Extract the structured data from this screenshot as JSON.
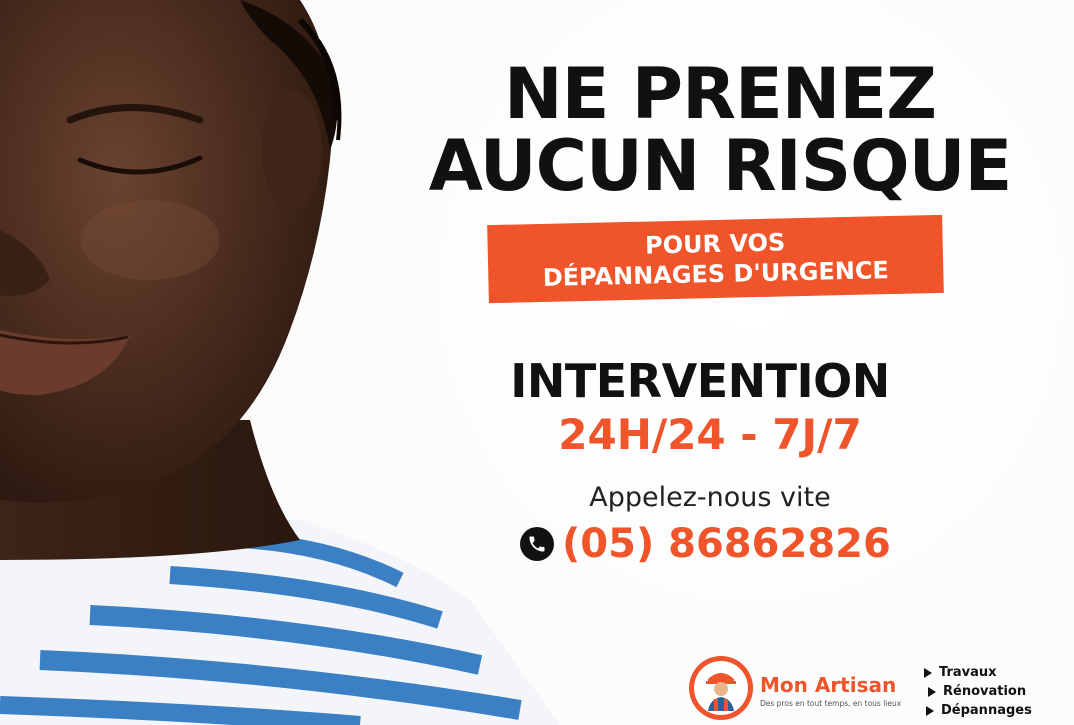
{
  "headline": {
    "line1": "NE PRENEZ",
    "line2": "AUCUN RISQUE"
  },
  "banner": {
    "line1": "POUR VOS",
    "line2": "DÉPANNAGES D'URGENCE"
  },
  "availability": {
    "title": "INTERVENTION",
    "hours": "24H/24 - 7J/7"
  },
  "contact": {
    "cta": "Appelez-nous vite",
    "phone": "(05) 86862826",
    "icon": "phone-icon"
  },
  "brand": {
    "name": "Mon Artisan",
    "tagline": "Des pros en tout temps, en tous lieux"
  },
  "services": [
    {
      "label": "Travaux"
    },
    {
      "label": "Rénovation"
    },
    {
      "label": "Dépannages"
    }
  ],
  "colors": {
    "accent": "#f0542a",
    "text": "#111111",
    "background": "#ffffff",
    "stripe_blue": "#3b7fc4"
  }
}
